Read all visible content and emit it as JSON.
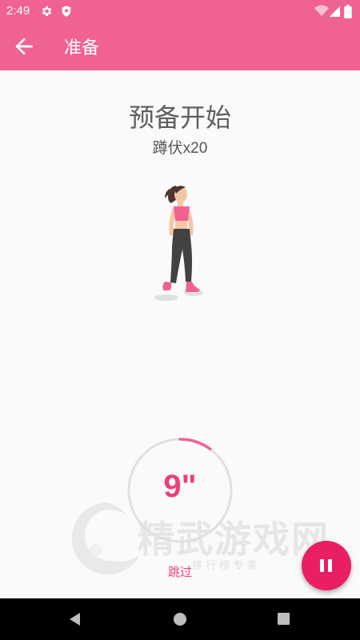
{
  "status_bar": {
    "time": "2:49"
  },
  "app_bar": {
    "title": "准备"
  },
  "main": {
    "heading": "预备开始",
    "exercise": "蹲伏x20"
  },
  "timer": {
    "countdown": "9\"",
    "progress_fraction": 0.1
  },
  "skip_label": "跳过",
  "watermark": {
    "main_text": "精武游戏网",
    "sub_text": "排 行 榜 专 家"
  },
  "colors": {
    "primary": "#f06292",
    "accent": "#e91e63",
    "timer_text": "#ec407a"
  }
}
